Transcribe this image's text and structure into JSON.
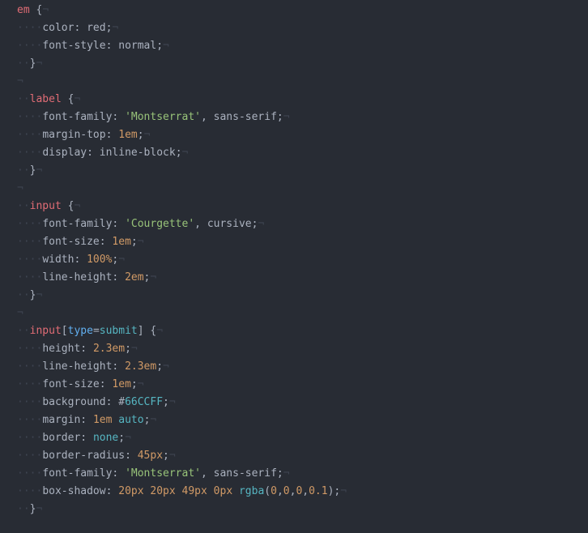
{
  "tokens": [
    [
      [
        "sel",
        "em"
      ],
      [
        "ws",
        " "
      ],
      [
        "punc",
        "{"
      ],
      [
        "eol",
        "¬"
      ]
    ],
    [
      [
        "ind",
        "····"
      ],
      [
        "prop",
        "color"
      ],
      [
        "punc",
        ":"
      ],
      [
        "ws",
        " "
      ],
      [
        "ident",
        "red"
      ],
      [
        "punc",
        ";"
      ],
      [
        "eol",
        "¬"
      ]
    ],
    [
      [
        "ind",
        "····"
      ],
      [
        "prop",
        "font-style"
      ],
      [
        "punc",
        ":"
      ],
      [
        "ws",
        " "
      ],
      [
        "ident",
        "normal"
      ],
      [
        "punc",
        ";"
      ],
      [
        "eol",
        "¬"
      ]
    ],
    [
      [
        "ind",
        "··"
      ],
      [
        "punc",
        "}"
      ],
      [
        "eol",
        "¬"
      ]
    ],
    [
      [
        "eol",
        "¬"
      ]
    ],
    [
      [
        "ind",
        "··"
      ],
      [
        "sel",
        "label"
      ],
      [
        "ws",
        " "
      ],
      [
        "punc",
        "{"
      ],
      [
        "eol",
        "¬"
      ]
    ],
    [
      [
        "ind",
        "····"
      ],
      [
        "prop",
        "font-family"
      ],
      [
        "punc",
        ":"
      ],
      [
        "ws",
        " "
      ],
      [
        "str",
        "'Montserrat'"
      ],
      [
        "punc",
        ","
      ],
      [
        "ws",
        " "
      ],
      [
        "ident",
        "sans-serif"
      ],
      [
        "punc",
        ";"
      ],
      [
        "eol",
        "¬"
      ]
    ],
    [
      [
        "ind",
        "····"
      ],
      [
        "prop",
        "margin-top"
      ],
      [
        "punc",
        ":"
      ],
      [
        "ws",
        " "
      ],
      [
        "num",
        "1em"
      ],
      [
        "punc",
        ";"
      ],
      [
        "eol",
        "¬"
      ]
    ],
    [
      [
        "ind",
        "····"
      ],
      [
        "prop",
        "display"
      ],
      [
        "punc",
        ":"
      ],
      [
        "ws",
        " "
      ],
      [
        "ident",
        "inline-block"
      ],
      [
        "punc",
        ";"
      ],
      [
        "eol",
        "¬"
      ]
    ],
    [
      [
        "ind",
        "··"
      ],
      [
        "punc",
        "}"
      ],
      [
        "eol",
        "¬"
      ]
    ],
    [
      [
        "eol",
        "¬"
      ]
    ],
    [
      [
        "ind",
        "··"
      ],
      [
        "sel",
        "input"
      ],
      [
        "ws",
        " "
      ],
      [
        "punc",
        "{"
      ],
      [
        "eol",
        "¬"
      ]
    ],
    [
      [
        "ind",
        "····"
      ],
      [
        "prop",
        "font-family"
      ],
      [
        "punc",
        ":"
      ],
      [
        "ws",
        " "
      ],
      [
        "str",
        "'Courgette'"
      ],
      [
        "punc",
        ","
      ],
      [
        "ws",
        " "
      ],
      [
        "ident",
        "cursive"
      ],
      [
        "punc",
        ";"
      ],
      [
        "eol",
        "¬"
      ]
    ],
    [
      [
        "ind",
        "····"
      ],
      [
        "prop",
        "font-size"
      ],
      [
        "punc",
        ":"
      ],
      [
        "ws",
        " "
      ],
      [
        "num",
        "1em"
      ],
      [
        "punc",
        ";"
      ],
      [
        "eol",
        "¬"
      ]
    ],
    [
      [
        "ind",
        "····"
      ],
      [
        "prop",
        "width"
      ],
      [
        "punc",
        ":"
      ],
      [
        "ws",
        " "
      ],
      [
        "num",
        "100%"
      ],
      [
        "punc",
        ";"
      ],
      [
        "eol",
        "¬"
      ]
    ],
    [
      [
        "ind",
        "····"
      ],
      [
        "prop",
        "line-height"
      ],
      [
        "punc",
        ":"
      ],
      [
        "ws",
        " "
      ],
      [
        "num",
        "2em"
      ],
      [
        "punc",
        ";"
      ],
      [
        "eol",
        "¬"
      ]
    ],
    [
      [
        "ind",
        "··"
      ],
      [
        "punc",
        "}"
      ],
      [
        "eol",
        "¬"
      ]
    ],
    [
      [
        "eol",
        "¬"
      ]
    ],
    [
      [
        "ind",
        "··"
      ],
      [
        "sel",
        "input"
      ],
      [
        "punc",
        "["
      ],
      [
        "attr",
        "type"
      ],
      [
        "punc",
        "="
      ],
      [
        "attrval",
        "submit"
      ],
      [
        "punc",
        "]"
      ],
      [
        "ws",
        " "
      ],
      [
        "punc",
        "{"
      ],
      [
        "eol",
        "¬"
      ]
    ],
    [
      [
        "ind",
        "····"
      ],
      [
        "prop",
        "height"
      ],
      [
        "punc",
        ":"
      ],
      [
        "ws",
        " "
      ],
      [
        "num",
        "2.3em"
      ],
      [
        "punc",
        ";"
      ],
      [
        "eol",
        "¬"
      ]
    ],
    [
      [
        "ind",
        "····"
      ],
      [
        "prop",
        "line-height"
      ],
      [
        "punc",
        ":"
      ],
      [
        "ws",
        " "
      ],
      [
        "num",
        "2.3em"
      ],
      [
        "punc",
        ";"
      ],
      [
        "eol",
        "¬"
      ]
    ],
    [
      [
        "ind",
        "····"
      ],
      [
        "prop",
        "font-size"
      ],
      [
        "punc",
        ":"
      ],
      [
        "ws",
        " "
      ],
      [
        "num",
        "1em"
      ],
      [
        "punc",
        ";"
      ],
      [
        "eol",
        "¬"
      ]
    ],
    [
      [
        "ind",
        "····"
      ],
      [
        "prop",
        "background"
      ],
      [
        "punc",
        ":"
      ],
      [
        "ws",
        " "
      ],
      [
        "punc",
        "#"
      ],
      [
        "hex",
        "66CCFF"
      ],
      [
        "punc",
        ";"
      ],
      [
        "eol",
        "¬"
      ]
    ],
    [
      [
        "ind",
        "····"
      ],
      [
        "prop",
        "margin"
      ],
      [
        "punc",
        ":"
      ],
      [
        "ws",
        " "
      ],
      [
        "num",
        "1em"
      ],
      [
        "ws",
        " "
      ],
      [
        "kw",
        "auto"
      ],
      [
        "punc",
        ";"
      ],
      [
        "eol",
        "¬"
      ]
    ],
    [
      [
        "ind",
        "····"
      ],
      [
        "prop",
        "border"
      ],
      [
        "punc",
        ":"
      ],
      [
        "ws",
        " "
      ],
      [
        "kw",
        "none"
      ],
      [
        "punc",
        ";"
      ],
      [
        "eol",
        "¬"
      ]
    ],
    [
      [
        "ind",
        "····"
      ],
      [
        "prop",
        "border-radius"
      ],
      [
        "punc",
        ":"
      ],
      [
        "ws",
        " "
      ],
      [
        "num",
        "45px"
      ],
      [
        "punc",
        ";"
      ],
      [
        "eol",
        "¬"
      ]
    ],
    [
      [
        "ind",
        "····"
      ],
      [
        "prop",
        "font-family"
      ],
      [
        "punc",
        ":"
      ],
      [
        "ws",
        " "
      ],
      [
        "str",
        "'Montserrat'"
      ],
      [
        "punc",
        ","
      ],
      [
        "ws",
        " "
      ],
      [
        "ident",
        "sans-serif"
      ],
      [
        "punc",
        ";"
      ],
      [
        "eol",
        "¬"
      ]
    ],
    [
      [
        "ind",
        "····"
      ],
      [
        "prop",
        "box-shadow"
      ],
      [
        "punc",
        ":"
      ],
      [
        "ws",
        " "
      ],
      [
        "num",
        "20px"
      ],
      [
        "ws",
        " "
      ],
      [
        "num",
        "20px"
      ],
      [
        "ws",
        " "
      ],
      [
        "num",
        "49px"
      ],
      [
        "ws",
        " "
      ],
      [
        "num",
        "0px"
      ],
      [
        "ws",
        " "
      ],
      [
        "fn",
        "rgba"
      ],
      [
        "punc",
        "("
      ],
      [
        "num",
        "0"
      ],
      [
        "punc",
        ","
      ],
      [
        "num",
        "0"
      ],
      [
        "punc",
        ","
      ],
      [
        "num",
        "0"
      ],
      [
        "punc",
        ","
      ],
      [
        "num",
        "0.1"
      ],
      [
        "punc",
        ")"
      ],
      [
        "punc",
        ";"
      ],
      [
        "eol",
        "¬"
      ]
    ],
    [
      [
        "ind",
        "··"
      ],
      [
        "punc",
        "}"
      ],
      [
        "eol",
        "¬"
      ]
    ]
  ]
}
